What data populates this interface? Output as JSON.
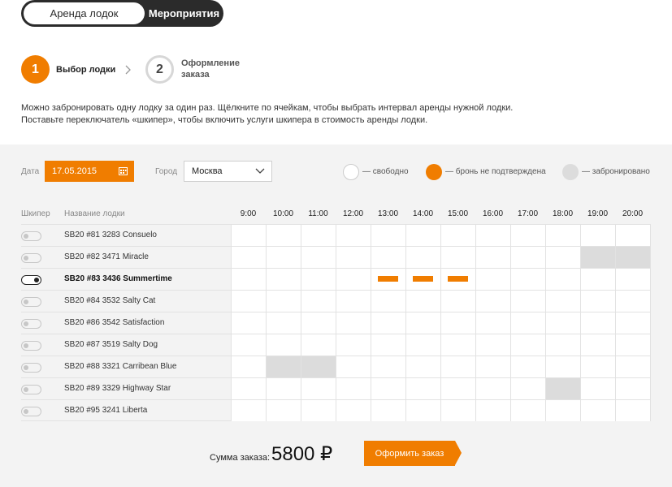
{
  "top_toggle": {
    "boats": "Аренда лодок",
    "events": "Мероприятия"
  },
  "steps": [
    {
      "num": "1",
      "label": "Выбор лодки"
    },
    {
      "num": "2",
      "label": "Оформление заказа"
    }
  ],
  "info": [
    "Можно забронировать одну лодку за один раз. Щёлкните по ячейкам, чтобы выбрать интервал аренды нужной лодки.",
    "Поставьте переключатель «шкипер», чтобы включить услуги шкипера в стоимость аренды лодки."
  ],
  "filters": {
    "date_label": "Дата",
    "date_value": "17.05.2015",
    "city_label": "Город",
    "city_value": "Москва"
  },
  "legend": {
    "free": "— свободно",
    "pending": "— бронь не подтверждена",
    "booked": "— забронировано"
  },
  "colors": {
    "accent": "#f07d00",
    "booked": "#dcdcdc"
  },
  "table": {
    "col_skipper": "Шкипер",
    "col_boat": "Название лодки",
    "times": [
      "9:00",
      "10:00",
      "11:00",
      "12:00",
      "13:00",
      "14:00",
      "15:00",
      "16:00",
      "17:00",
      "18:00",
      "19:00",
      "20:00"
    ],
    "rows": [
      {
        "name": "SB20 #81 3283 Consuelo",
        "skipper": false,
        "selected": false,
        "booked": [],
        "pending": []
      },
      {
        "name": "SB20 #82 3471 Miracle",
        "skipper": false,
        "selected": false,
        "booked": [
          "19:00",
          "20:00"
        ],
        "pending": []
      },
      {
        "name": "SB20 #83 3436 Summertime",
        "skipper": true,
        "selected": true,
        "booked": [],
        "pending": [
          "13:00",
          "14:00",
          "15:00"
        ]
      },
      {
        "name": "SB20 #84 3532 Salty Cat",
        "skipper": false,
        "selected": false,
        "booked": [],
        "pending": []
      },
      {
        "name": "SB20 #86 3542 Satisfaction",
        "skipper": false,
        "selected": false,
        "booked": [],
        "pending": []
      },
      {
        "name": "SB20 #87 3519 Salty Dog",
        "skipper": false,
        "selected": false,
        "booked": [],
        "pending": []
      },
      {
        "name": "SB20 #88 3321 Carribean Blue",
        "skipper": false,
        "selected": false,
        "booked": [
          "10:00",
          "11:00"
        ],
        "pending": []
      },
      {
        "name": "SB20 #89 3329 Highway Star",
        "skipper": false,
        "selected": false,
        "booked": [
          "18:00"
        ],
        "pending": []
      },
      {
        "name": "SB20 #95 3241 Liberta",
        "skipper": false,
        "selected": false,
        "booked": [],
        "pending": []
      }
    ]
  },
  "order": {
    "sum_label": "Сумма заказа:",
    "sum_value": "5800 ₽",
    "button": "Оформить заказ"
  }
}
